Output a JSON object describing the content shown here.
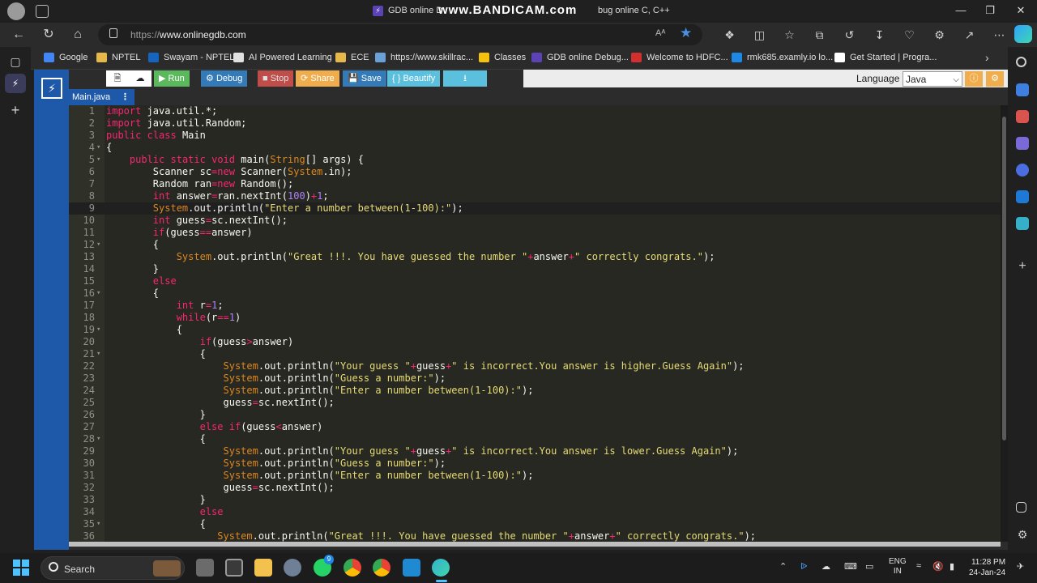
{
  "browser": {
    "window_title_left": "GDB online D",
    "watermark": "www.BANDICAM.com",
    "window_title_right": "bug online C, C++",
    "url_prefix": "https://",
    "url_host": "www.onlinegdb.com",
    "reader_label": "Aᴬ"
  },
  "bookmarks": [
    {
      "label": "Google",
      "color": "#4285f4"
    },
    {
      "label": "NPTEL",
      "color": "#e6b84a"
    },
    {
      "label": "Swayam - NPTEL",
      "color": "#1565c0"
    },
    {
      "label": "AI Powered Learning",
      "color": "#e0e0e0"
    },
    {
      "label": "ECE",
      "color": "#e6b84a"
    },
    {
      "label": "https://www.skillrac...",
      "color": "#6aa0d8"
    },
    {
      "label": "Classes",
      "color": "#f4c20d"
    },
    {
      "label": "GDB online Debug...",
      "color": "#5b43b5"
    },
    {
      "label": "Welcome to HDFC...",
      "color": "#d32f2f"
    },
    {
      "label": "rmk685.examly.io lo...",
      "color": "#1e88e5"
    },
    {
      "label": "Get Started | Progra...",
      "color": "#ffffff"
    }
  ],
  "toolbar": {
    "run": "Run",
    "debug": "Debug",
    "stop": "Stop",
    "share": "Share",
    "save": "Save",
    "beautify": "{ } Beautify",
    "download_icon": "⭳",
    "language_label": "Language",
    "language_value": "Java"
  },
  "file_tab": {
    "name": "Main.java",
    "menu": "⋮"
  },
  "colors": {
    "gdb_blue": "#1e58a8",
    "run_green": "#5cb85c",
    "stop_red": "#d9534f",
    "share_orange": "#f0ad4e",
    "keyword": "#f92672",
    "string": "#e6db74",
    "number": "#ae81ff",
    "type": "#66d9ef",
    "variable": "#fd971f"
  },
  "code": [
    {
      "n": "1",
      "fold": "",
      "t": "import java.util.*;"
    },
    {
      "n": "2",
      "fold": "",
      "t": "import java.util.Random;"
    },
    {
      "n": "3",
      "fold": "",
      "t": "public class Main"
    },
    {
      "n": "4",
      "fold": "▾",
      "t": "{"
    },
    {
      "n": "5",
      "fold": "▾",
      "t": "    public static void main(String[] args) {"
    },
    {
      "n": "6",
      "fold": "",
      "t": "        Scanner sc=new Scanner(System.in);"
    },
    {
      "n": "7",
      "fold": "",
      "t": "        Random ran=new Random();"
    },
    {
      "n": "8",
      "fold": "",
      "t": "        int answer=ran.nextInt(100)+1;"
    },
    {
      "n": "9",
      "fold": "",
      "t": "        System.out.println(\"Enter a number between(1-100):\");"
    },
    {
      "n": "10",
      "fold": "",
      "t": "        int guess=sc.nextInt();"
    },
    {
      "n": "11",
      "fold": "",
      "t": "        if(guess==answer)"
    },
    {
      "n": "12",
      "fold": "▾",
      "t": "        {"
    },
    {
      "n": "13",
      "fold": "",
      "t": "            System.out.println(\"Great !!!. You have guessed the number \"+answer+\" correctly congrats.\");"
    },
    {
      "n": "14",
      "fold": "",
      "t": "        }"
    },
    {
      "n": "15",
      "fold": "",
      "t": "        else"
    },
    {
      "n": "16",
      "fold": "▾",
      "t": "        {"
    },
    {
      "n": "17",
      "fold": "",
      "t": "            int r=1;"
    },
    {
      "n": "18",
      "fold": "",
      "t": "            while(r==1)"
    },
    {
      "n": "19",
      "fold": "▾",
      "t": "            {"
    },
    {
      "n": "20",
      "fold": "",
      "t": "                if(guess>answer)"
    },
    {
      "n": "21",
      "fold": "▾",
      "t": "                {"
    },
    {
      "n": "22",
      "fold": "",
      "t": "                    System.out.println(\"Your guess \"+guess+\" is incorrect.You answer is higher.Guess Again\");"
    },
    {
      "n": "23",
      "fold": "",
      "t": "                    System.out.println(\"Guess a number:\");"
    },
    {
      "n": "24",
      "fold": "",
      "t": "                    System.out.println(\"Enter a number between(1-100):\");"
    },
    {
      "n": "25",
      "fold": "",
      "t": "                    guess=sc.nextInt();"
    },
    {
      "n": "26",
      "fold": "",
      "t": "                }"
    },
    {
      "n": "27",
      "fold": "",
      "t": "                else if(guess<answer)"
    },
    {
      "n": "28",
      "fold": "▾",
      "t": "                {"
    },
    {
      "n": "29",
      "fold": "",
      "t": "                    System.out.println(\"Your guess \"+guess+\" is incorrect.You answer is lower.Guess Again\");"
    },
    {
      "n": "30",
      "fold": "",
      "t": "                    System.out.println(\"Guess a number:\");"
    },
    {
      "n": "31",
      "fold": "",
      "t": "                    System.out.println(\"Enter a number between(1-100):\");"
    },
    {
      "n": "32",
      "fold": "",
      "t": "                    guess=sc.nextInt();"
    },
    {
      "n": "33",
      "fold": "",
      "t": "                }"
    },
    {
      "n": "34",
      "fold": "",
      "t": "                else"
    },
    {
      "n": "35",
      "fold": "▾",
      "t": "                {"
    },
    {
      "n": "36",
      "fold": "",
      "t": "                   System.out.println(\"Great !!!. You have guessed the number \"+answer+\" correctly congrats.\");"
    }
  ],
  "active_line": "9",
  "taskbar": {
    "search_label": "Search",
    "lang_top": "ENG",
    "lang_bottom": "IN",
    "time": "11:28 PM",
    "date": "24-Jan-24",
    "badge": "9"
  }
}
